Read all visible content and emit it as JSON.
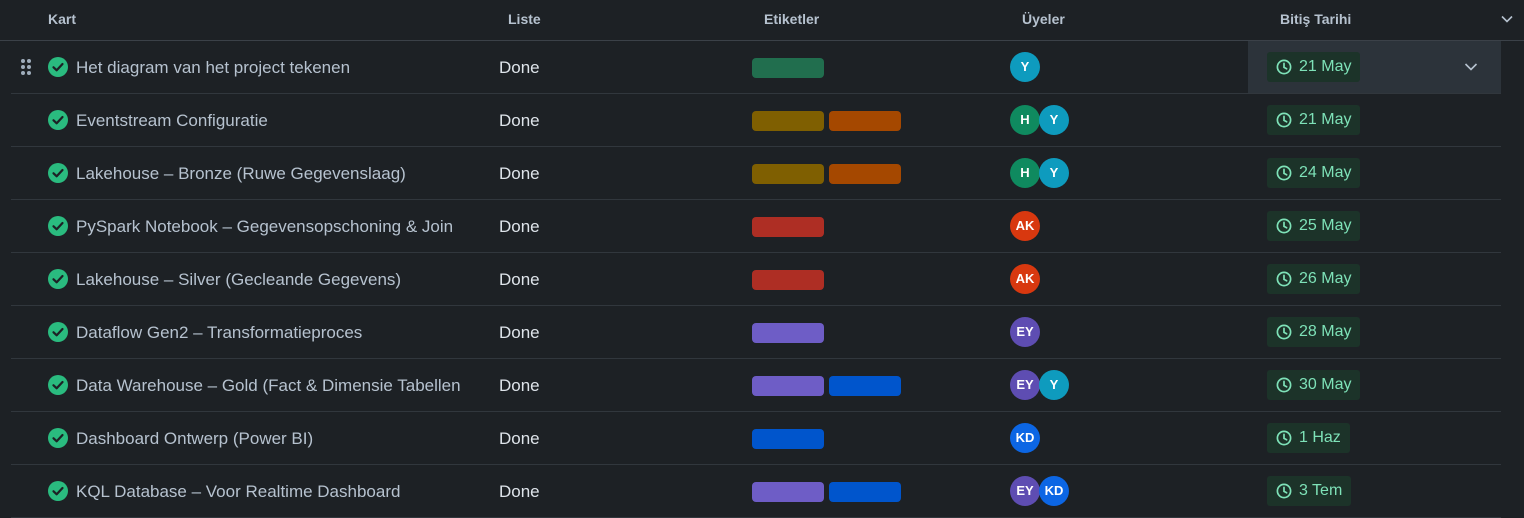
{
  "columns": {
    "card": "Kart",
    "list": "Liste",
    "labels": "Etiketler",
    "members": "Üyeler",
    "due": "Bitiş Tarihi"
  },
  "label_colors": {
    "green": "#216e4e",
    "olive": "#7f5f01",
    "orange": "#a54800",
    "red": "#ae2e24",
    "purple": "#6e5dc6",
    "blue": "#0055cc"
  },
  "member_colors": {
    "Y": "#0e9bbe",
    "H": "#0f8a5f",
    "AK": "#d8380f",
    "EY": "#5e4db2",
    "KD": "#0c66e4"
  },
  "status_color": "#2abb7f",
  "due_color": "#7ee2b8",
  "rows": [
    {
      "title": "Het diagram van het project tekenen",
      "list": "Done",
      "labels": [
        "green"
      ],
      "members": [
        "Y"
      ],
      "due": "21 May",
      "selected": true
    },
    {
      "title": "Eventstream Configuratie",
      "list": "Done",
      "labels": [
        "olive",
        "orange"
      ],
      "members": [
        "H",
        "Y"
      ],
      "due": "21 May"
    },
    {
      "title": "Lakehouse – Bronze (Ruwe Gegevenslaag)",
      "list": "Done",
      "labels": [
        "olive",
        "orange"
      ],
      "members": [
        "H",
        "Y"
      ],
      "due": "24 May"
    },
    {
      "title": "PySpark Notebook – Gegevensopschoning & Join",
      "list": "Done",
      "labels": [
        "red"
      ],
      "members": [
        "AK"
      ],
      "due": "25 May"
    },
    {
      "title": "Lakehouse – Silver (Gecleande Gegevens)",
      "list": "Done",
      "labels": [
        "red"
      ],
      "members": [
        "AK"
      ],
      "due": "26 May"
    },
    {
      "title": "Dataflow Gen2 – Transformatieproces",
      "list": "Done",
      "labels": [
        "purple"
      ],
      "members": [
        "EY"
      ],
      "due": "28 May"
    },
    {
      "title": "Data Warehouse – Gold (Fact & Dimensie Tabellen",
      "list": "Done",
      "labels": [
        "purple",
        "blue"
      ],
      "members": [
        "EY",
        "Y"
      ],
      "due": "30 May"
    },
    {
      "title": "Dashboard Ontwerp (Power BI)",
      "list": "Done",
      "labels": [
        "blue"
      ],
      "members": [
        "KD"
      ],
      "due": "1 Haz"
    },
    {
      "title": "KQL Database – Voor Realtime Dashboard",
      "list": "Done",
      "labels": [
        "purple",
        "blue"
      ],
      "members": [
        "EY",
        "KD"
      ],
      "due": "3 Tem"
    }
  ]
}
